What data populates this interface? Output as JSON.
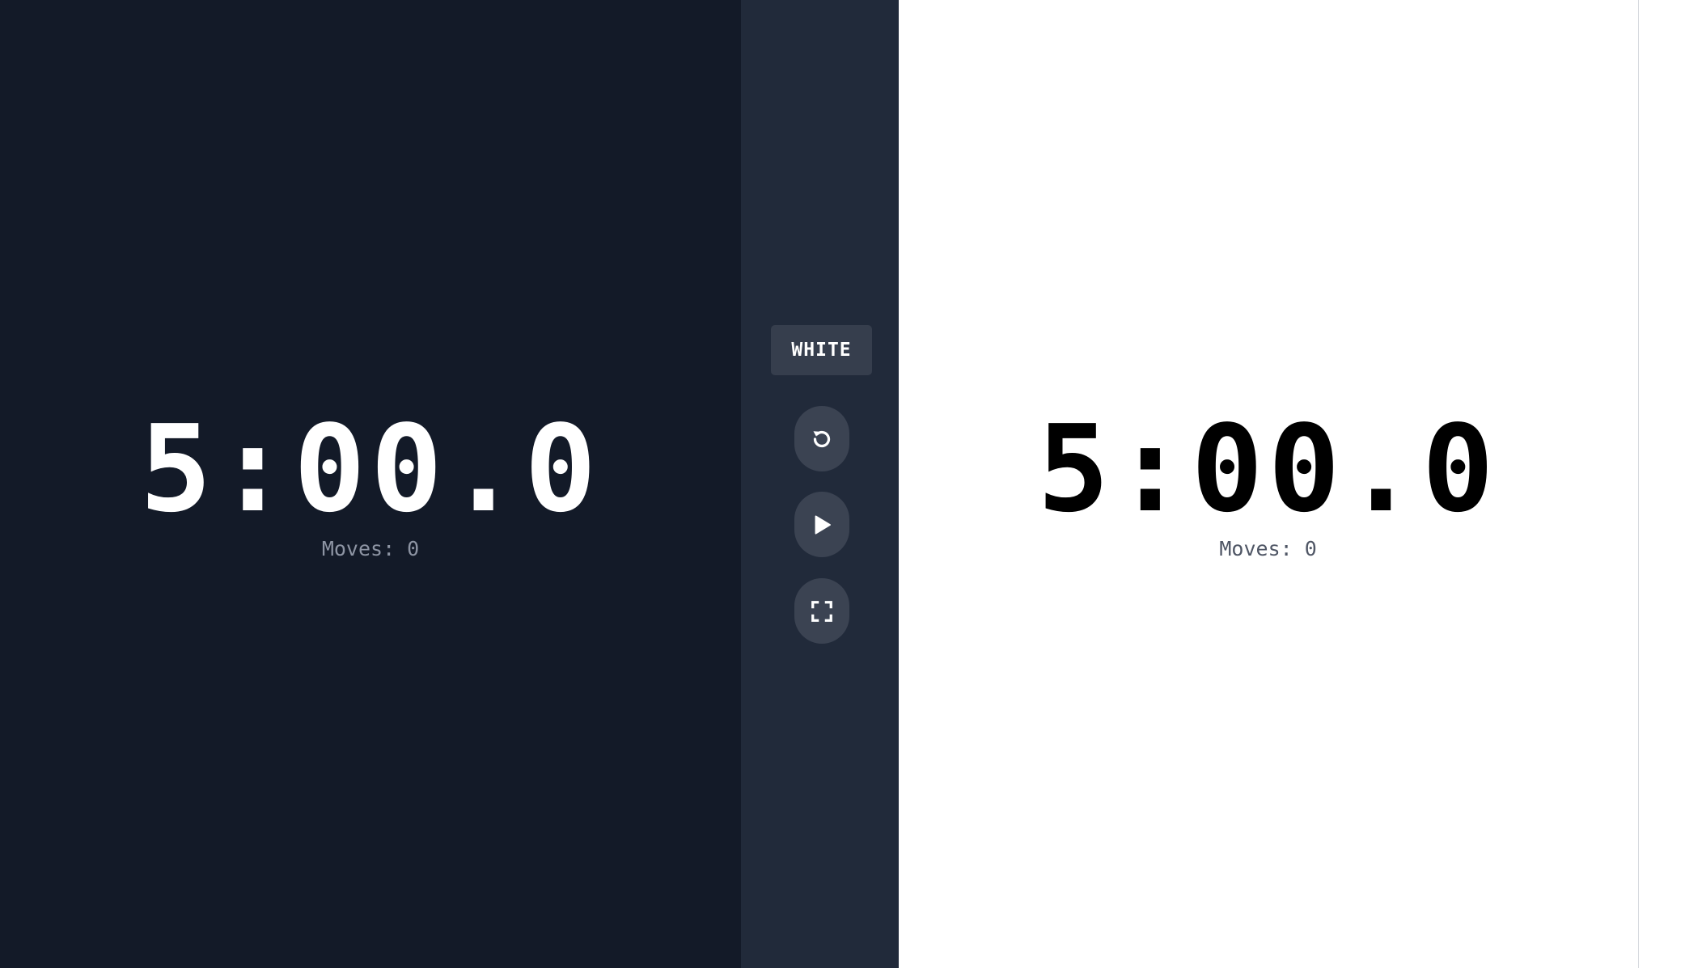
{
  "players": {
    "black": {
      "time": "5:00.0",
      "moves_label": "Moves: 0",
      "background": "#131a28",
      "text_color": "#ffffff"
    },
    "white": {
      "time": "5:00.0",
      "moves_label": "Moves: 0",
      "background": "#ffffff",
      "text_color": "#000000"
    }
  },
  "controls": {
    "turn_label": "WHITE",
    "buttons": [
      {
        "name": "reset",
        "icon": "reset-icon"
      },
      {
        "name": "play",
        "icon": "play-icon"
      },
      {
        "name": "fullscreen",
        "icon": "fullscreen-icon"
      }
    ],
    "bar_color": "#212a3a",
    "button_color": "#3b4352"
  }
}
